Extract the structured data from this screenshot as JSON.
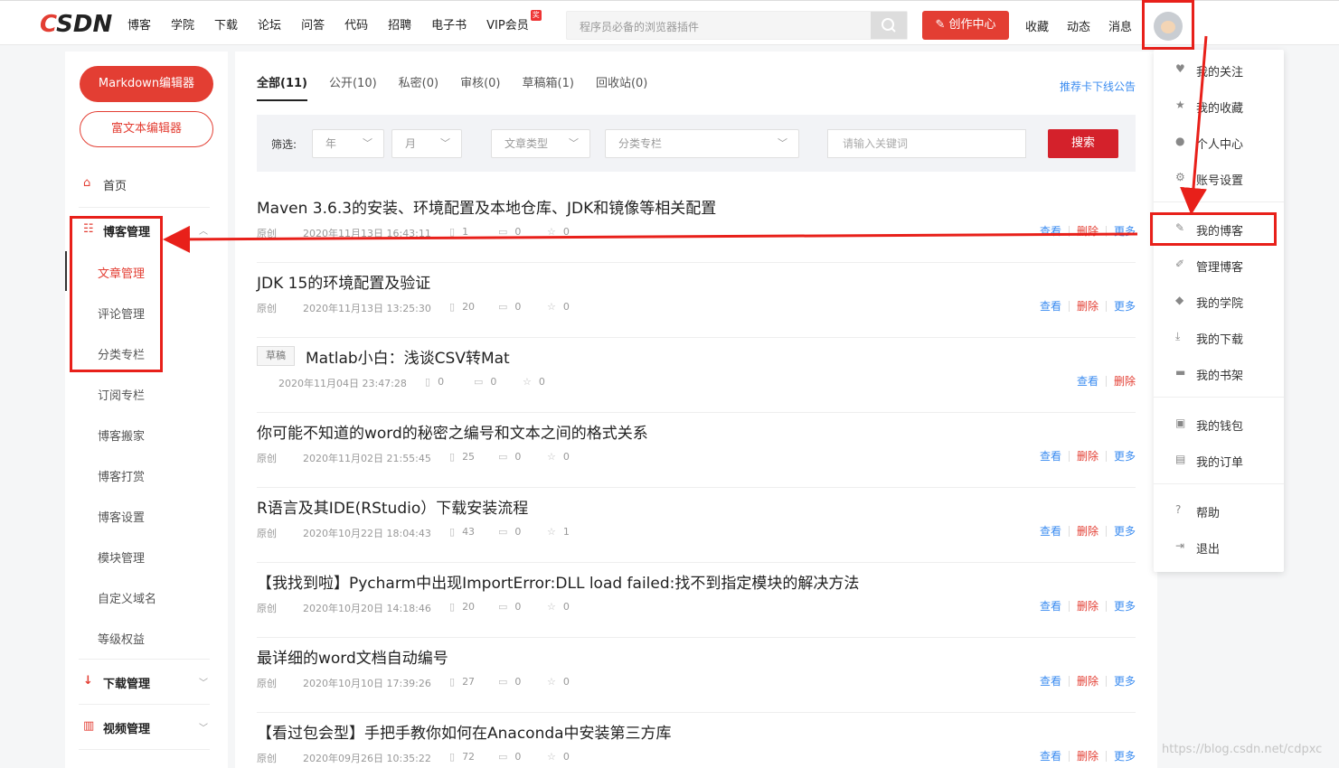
{
  "header": {
    "logo": "CSDN",
    "nav": [
      "博客",
      "学院",
      "下载",
      "论坛",
      "问答",
      "代码",
      "招聘",
      "电子书",
      "VIP会员"
    ],
    "vip_badge": "奖",
    "search_placeholder": "程序员必备的浏览器插件",
    "create_label": "创作中心",
    "links": [
      "收藏",
      "动态",
      "消息"
    ]
  },
  "sidebar": {
    "markdown_btn": "Markdown编辑器",
    "richtext_btn": "富文本编辑器",
    "home": "首页",
    "blog_manage": "博客管理",
    "sub_items": [
      "文章管理",
      "评论管理",
      "分类专栏",
      "订阅专栏",
      "博客搬家",
      "博客打赏",
      "博客设置",
      "模块管理",
      "自定义域名",
      "等级权益"
    ],
    "download_manage": "下载管理",
    "video_manage": "视频管理"
  },
  "main": {
    "tabs": [
      "全部(11)",
      "公开(10)",
      "私密(0)",
      "审核(0)",
      "草稿箱(1)",
      "回收站(0)"
    ],
    "notice": "推荐卡下线公告",
    "filter": {
      "label": "筛选:",
      "year": "年",
      "month": "月",
      "type": "文章类型",
      "column": "分类专栏",
      "keyword_placeholder": "请输入关键词",
      "search_btn": "搜索"
    },
    "actions": {
      "view": "查看",
      "delete": "删除",
      "more": "更多"
    },
    "articles": [
      {
        "title": "Maven 3.6.3的安装、环境配置及本地仓库、JDK和镜像等相关配置",
        "type": "原创",
        "time": "2020年11月13日 16:43:11",
        "reads": "1",
        "comments": "0",
        "stars": "0"
      },
      {
        "title": "JDK 15的环境配置及验证",
        "type": "原创",
        "time": "2020年11月13日 13:25:30",
        "reads": "20",
        "comments": "0",
        "stars": "0"
      },
      {
        "title": "Matlab小白：浅谈CSV转Mat",
        "type": "草稿",
        "time": "2020年11月04日 23:47:28",
        "reads": "0",
        "comments": "0",
        "stars": "0"
      },
      {
        "title": "你可能不知道的word的秘密之编号和文本之间的格式关系",
        "type": "原创",
        "time": "2020年11月02日 21:55:45",
        "reads": "25",
        "comments": "0",
        "stars": "0"
      },
      {
        "title": "R语言及其IDE(RStudio）下载安装流程",
        "type": "原创",
        "time": "2020年10月22日 18:04:43",
        "reads": "43",
        "comments": "0",
        "stars": "1"
      },
      {
        "title": "【我找到啦】Pycharm中出现ImportError:DLL load failed:找不到指定模块的解决方法",
        "type": "原创",
        "time": "2020年10月20日 14:18:46",
        "reads": "20",
        "comments": "0",
        "stars": "0"
      },
      {
        "title": "最详细的word文档自动编号",
        "type": "原创",
        "time": "2020年10月10日 17:39:26",
        "reads": "27",
        "comments": "0",
        "stars": "0"
      },
      {
        "title": "【看过包会型】手把手教你如何在Anaconda中安装第三方库",
        "type": "原创",
        "time": "2020年09月26日 10:35:22",
        "reads": "72",
        "comments": "0",
        "stars": "0"
      }
    ]
  },
  "dropdown": {
    "items": [
      "我的关注",
      "我的收藏",
      "个人中心",
      "账号设置",
      "我的博客",
      "管理博客",
      "我的学院",
      "我的下载",
      "我的书架",
      "我的钱包",
      "我的订单",
      "帮助",
      "退出"
    ]
  },
  "watermark": "https://blog.csdn.net/cdpxc",
  "colors": {
    "brand": "#e33e33",
    "link": "#3b8cf0",
    "annotation": "#e8201a"
  }
}
